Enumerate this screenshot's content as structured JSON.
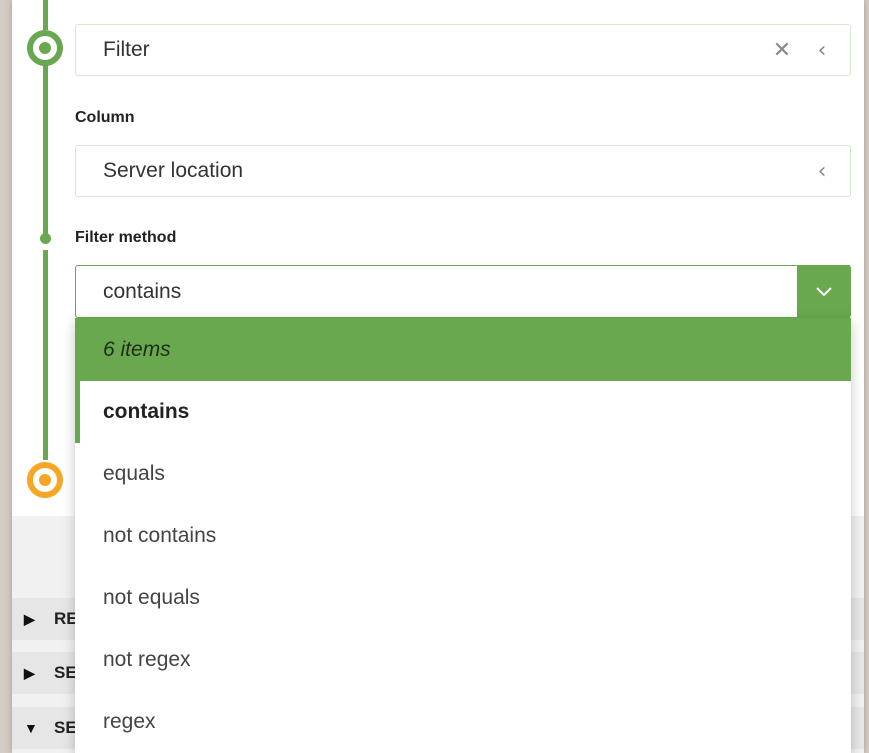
{
  "filter_field": {
    "value": "Filter",
    "clear_icon": "close-icon",
    "collapse_icon": "chevron-left-icon"
  },
  "column": {
    "label": "Column",
    "value": "Server location",
    "collapse_icon": "chevron-left-icon"
  },
  "filter_method": {
    "label": "Filter method",
    "selected": "contains",
    "dropdown_icon": "chevron-down-icon"
  },
  "dropdown": {
    "header": "6 items",
    "options": [
      "contains",
      "equals",
      "not contains",
      "not equals",
      "not regex",
      "regex"
    ],
    "selected_index": 0
  },
  "sections": [
    {
      "label": "RE",
      "state": "collapsed"
    },
    {
      "label": "SE",
      "state": "collapsed"
    },
    {
      "label": "SE",
      "state": "expanded"
    }
  ],
  "colors": {
    "accent": "#6aa84f",
    "node_current": "#f5a623"
  }
}
